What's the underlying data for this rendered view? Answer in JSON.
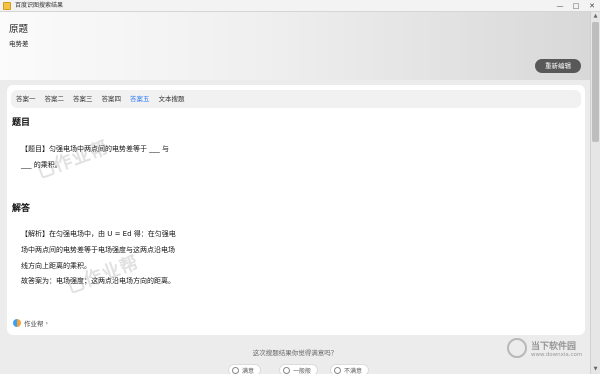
{
  "window": {
    "title": "百度识图搜索结果",
    "controls": [
      "—",
      "□",
      "✕"
    ]
  },
  "header": {
    "title": "原题",
    "subtitle": "电势差",
    "reedit_button": "重新编辑"
  },
  "tabs": [
    {
      "label": "答案一",
      "active": false
    },
    {
      "label": "答案二",
      "active": false
    },
    {
      "label": "答案三",
      "active": false
    },
    {
      "label": "答案四",
      "active": false
    },
    {
      "label": "答案五",
      "active": true
    },
    {
      "label": "文本搜题",
      "active": false
    }
  ],
  "question": {
    "heading": "题目",
    "line1": "【题目】匀强电场中两点间的电势差等于 ___ 与",
    "line2": "___ 的乘积。"
  },
  "answer": {
    "heading": "解答",
    "line1": "【解析】在匀强电场中，由 U = Ed 得：在匀强电",
    "line2": "场中两点间的电势差等于电场强度与这两点沿电场",
    "line3": "线方向上距离的乘积。",
    "line4": "故答案为：电场强度；这两点沿电场方向的距离。"
  },
  "watermark": {
    "text": "作业帮"
  },
  "source": {
    "label": "作业帮",
    "chevron": "›"
  },
  "feedback": {
    "question": "这次搜题结果你觉得满意吗？",
    "options": [
      "满意",
      "一般般",
      "不满意"
    ]
  },
  "site_logo": {
    "cn": "当下软件园",
    "en": "www.downxia.com"
  },
  "colors": {
    "active_tab": "#2f7cf6",
    "reedit_button_bg": "#585858",
    "panel_bg": "#ffffff",
    "page_bg": "#ececec"
  }
}
